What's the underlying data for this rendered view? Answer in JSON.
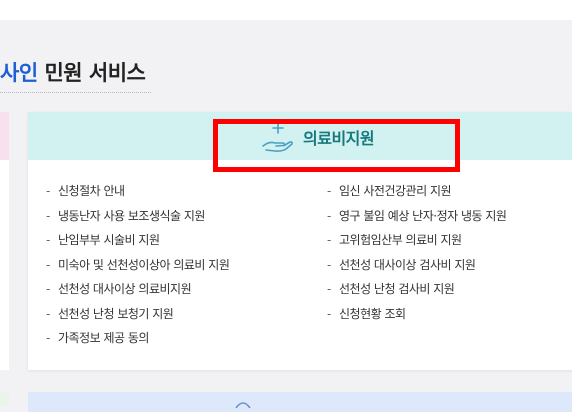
{
  "page": {
    "title_accent": "사인",
    "title_rest": " 민원 서비스"
  },
  "card": {
    "title": "의료비지원",
    "icon": "hand-plus-icon",
    "accent_color": "#16797c",
    "header_color": "#d2f2f2"
  },
  "services_left": [
    "신청절차 안내",
    "냉동난자 사용 보조생식술 지원",
    "난임부부 시술비 지원",
    "미숙아 및 선천성이상아 의료비 지원",
    "선천성 대사이상 의료비지원",
    "선천성 난청 보청기 지원",
    "가족정보 제공 동의"
  ],
  "services_right": [
    "임신 사전건강관리 지원",
    "영구 불임 예상 난자·정자 냉동 지원",
    "고위험임산부 의료비 지원",
    "선천성 대사이상 검사비 지원",
    "선천성 난청 검사비 지원",
    "신청현황 조회"
  ],
  "bullet": "-",
  "highlight_color": "#ff0000"
}
